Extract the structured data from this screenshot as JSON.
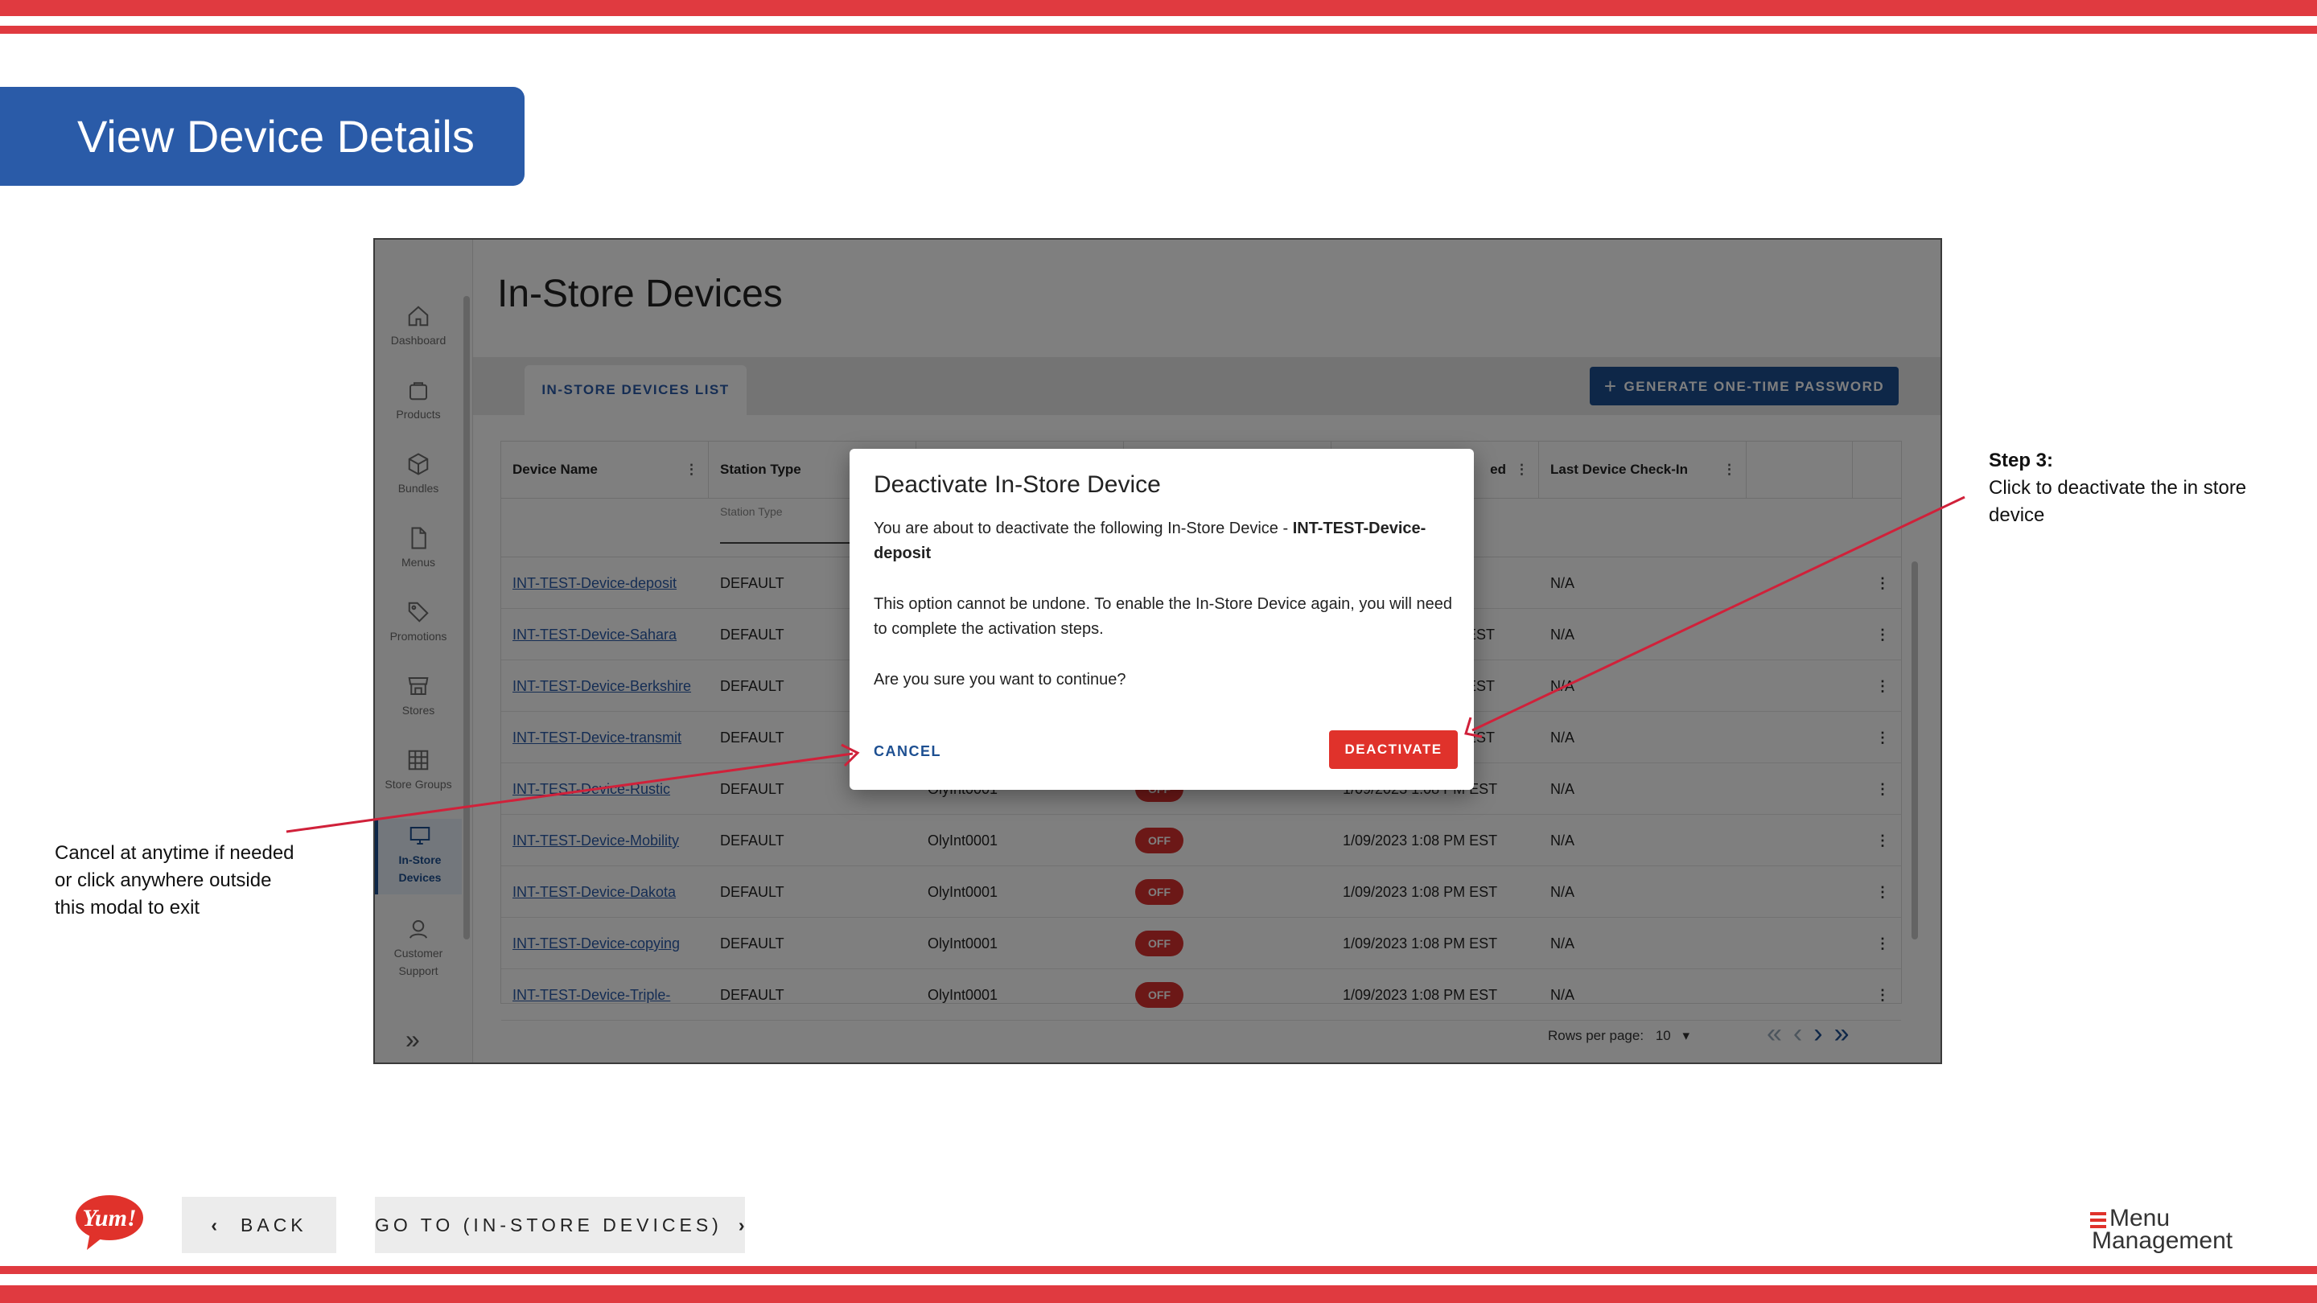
{
  "slide": {
    "title": "View Device Details",
    "colors": {
      "accent_red": "#e03a40",
      "brand_blue": "#2a5ba8"
    }
  },
  "app": {
    "page_title": "In-Store Devices",
    "sidebar": {
      "items": [
        {
          "label": "Dashboard",
          "icon": "home-icon"
        },
        {
          "label": "Products",
          "icon": "bag-icon"
        },
        {
          "label": "Bundles",
          "icon": "box-icon"
        },
        {
          "label": "Menus",
          "icon": "document-icon"
        },
        {
          "label": "Promotions",
          "icon": "tag-icon"
        },
        {
          "label": "Stores",
          "icon": "store-icon"
        },
        {
          "label": "Store Groups",
          "icon": "grid-icon"
        },
        {
          "label_line1": "In-Store",
          "label_line2": "Devices",
          "icon": "monitor-icon",
          "active": true
        },
        {
          "label_line1": "Customer",
          "label_line2": "Support",
          "icon": "support-icon"
        }
      ],
      "expand_icon": "chevron-double-right-icon"
    },
    "tab": "IN-STORE DEVICES LIST",
    "generate_button": "GENERATE ONE-TIME PASSWORD",
    "table": {
      "columns": [
        "Device Name",
        "Station Type",
        "",
        "",
        "ed",
        "Last Device Check-In"
      ],
      "filter_placeholder": "Station Type",
      "rows": [
        {
          "name": "INT-TEST-Device-deposit",
          "station": "DEFAULT",
          "station_id": "",
          "status": "",
          "date": "",
          "last": "N/A"
        },
        {
          "name": "INT-TEST-Device-Sahara",
          "station": "DEFAULT",
          "station_id": "",
          "status": "",
          "date": "EST",
          "last": "N/A"
        },
        {
          "name": "INT-TEST-Device-Berkshire",
          "station": "DEFAULT",
          "station_id": "",
          "status": "",
          "date": "EST",
          "last": "N/A"
        },
        {
          "name": "INT-TEST-Device-transmit",
          "station": "DEFAULT",
          "station_id": "",
          "status": "",
          "date": "EST",
          "last": "N/A"
        },
        {
          "name": "INT-TEST-Device-Rustic",
          "station": "DEFAULT",
          "station_id": "OlyInt0001",
          "status": "OFF",
          "date": "1/09/2023 1:08 PM EST",
          "last": "N/A"
        },
        {
          "name": "INT-TEST-Device-Mobility",
          "station": "DEFAULT",
          "station_id": "OlyInt0001",
          "status": "OFF",
          "date": "1/09/2023 1:08 PM EST",
          "last": "N/A"
        },
        {
          "name": "INT-TEST-Device-Dakota",
          "station": "DEFAULT",
          "station_id": "OlyInt0001",
          "status": "OFF",
          "date": "1/09/2023 1:08 PM EST",
          "last": "N/A"
        },
        {
          "name": "INT-TEST-Device-copying",
          "station": "DEFAULT",
          "station_id": "OlyInt0001",
          "status": "OFF",
          "date": "1/09/2023 1:08 PM EST",
          "last": "N/A"
        },
        {
          "name": "INT-TEST-Device-Triple-",
          "station": "DEFAULT",
          "station_id": "OlyInt0001",
          "status": "OFF",
          "date": "1/09/2023 1:08 PM EST",
          "last": "N/A"
        }
      ]
    },
    "pagination": {
      "rows_label": "Rows per page:",
      "rows_value": "10",
      "icons": "first-page last-page prev next"
    }
  },
  "modal": {
    "title": "Deactivate In-Store Device",
    "line1_prefix": "You are about to deactivate the following In-Store Device - ",
    "line1_device": "INT-TEST-Device-deposit",
    "line2": "This option cannot be undone. To enable the In-Store Device again, you will need to complete the activation steps.",
    "line3": "Are you sure you want to continue?",
    "cancel": "CANCEL",
    "deactivate": "DEACTIVATE"
  },
  "annotations": {
    "left_note": "Cancel at anytime if needed or click anywhere outside this modal to exit",
    "step_label": "Step 3:",
    "step_text": "Click to deactivate the in store device"
  },
  "footer": {
    "back": "BACK",
    "goto": "GO TO (IN-STORE DEVICES)",
    "yum_logo": "Yum!",
    "brand_line1": "Menu",
    "brand_line2": "Management"
  }
}
